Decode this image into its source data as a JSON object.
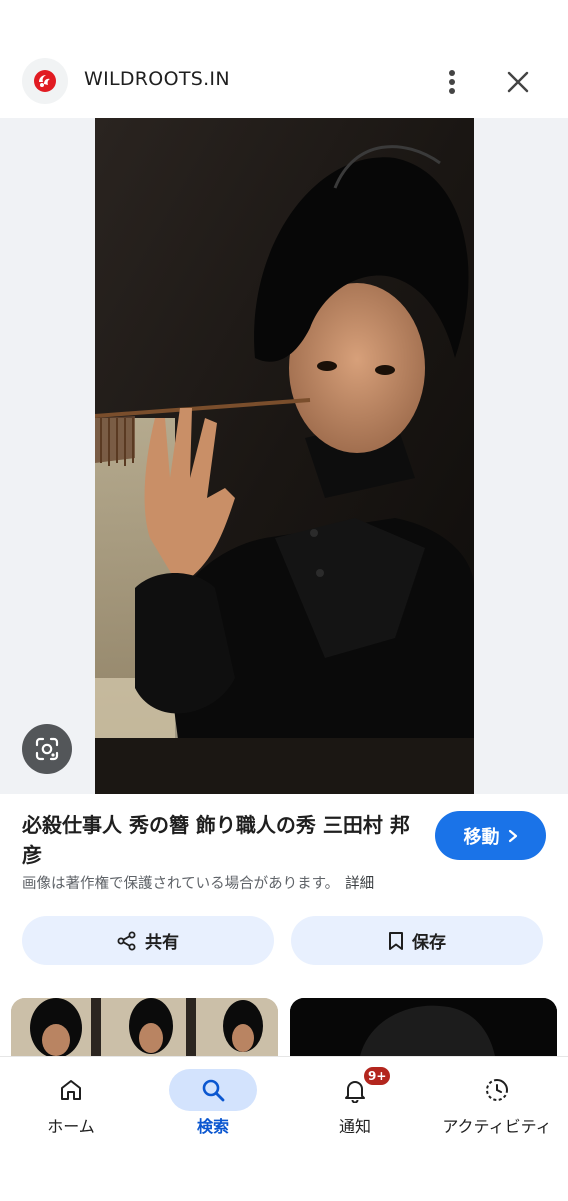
{
  "header": {
    "site_name": "WILDROOTS.IN",
    "site_icon": "wildroots-logo-icon",
    "more_icon": "more-vert-icon",
    "close_icon": "close-icon"
  },
  "image": {
    "lens_icon": "google-lens-icon"
  },
  "result": {
    "title": "必殺仕事人 秀の簪 飾り職人の秀 三田村 邦彦",
    "visit_label": "移動",
    "copyright_notice": "画像は著作権で保護されている場合があります。",
    "details_link": "詳細"
  },
  "actions": {
    "share_label": "共有",
    "save_label": "保存"
  },
  "bottom_nav": {
    "items": [
      {
        "label": "ホーム",
        "icon": "home-icon"
      },
      {
        "label": "検索",
        "icon": "search-icon"
      },
      {
        "label": "通知",
        "icon": "bell-icon",
        "badge": "9+"
      },
      {
        "label": "アクティビティ",
        "icon": "activity-icon"
      }
    ]
  },
  "colors": {
    "accent": "#1a73e8",
    "active_nav": "#0b57d0",
    "pill_bg": "#e8f0fe",
    "badge": "#b3261e"
  }
}
